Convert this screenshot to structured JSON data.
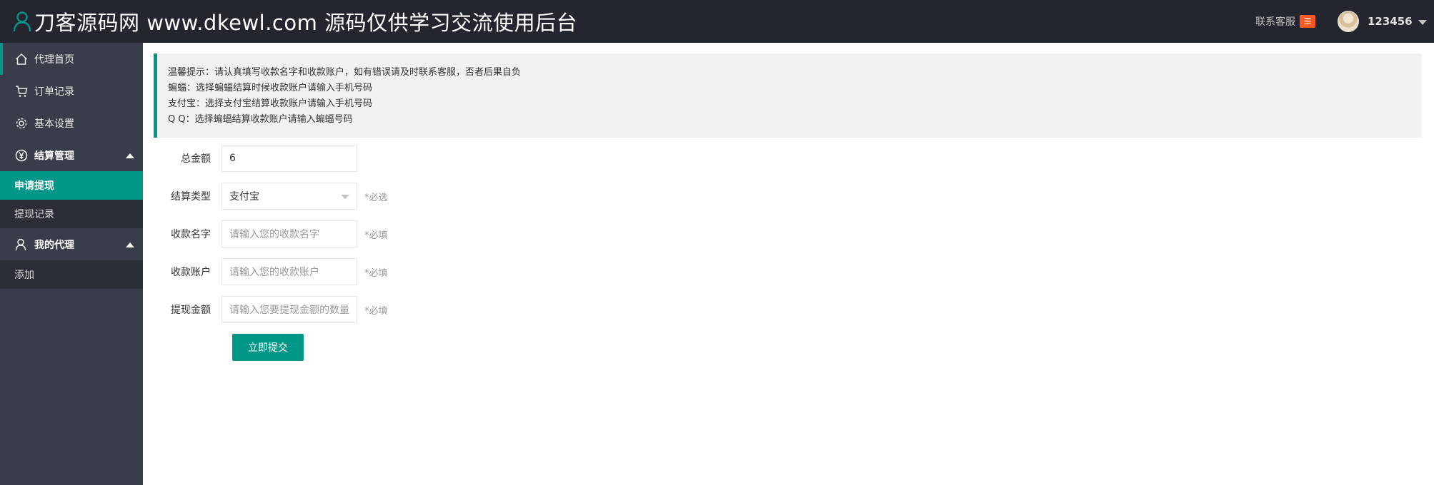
{
  "header": {
    "title": "刀客源码网 www.dkewl.com 源码仅供学习交流使用后台",
    "contact_label": "联系客服",
    "contact_badge": "☰",
    "username": "123456"
  },
  "sidebar": {
    "items": [
      {
        "label": "代理首页",
        "icon": "home-icon"
      },
      {
        "label": "订单记录",
        "icon": "cart-icon"
      },
      {
        "label": "基本设置",
        "icon": "gear-icon"
      }
    ],
    "groups": [
      {
        "label": "结算管理",
        "icon": "yen-icon",
        "children": [
          {
            "label": "申请提现",
            "active": true
          },
          {
            "label": "提现记录",
            "active": false
          }
        ]
      },
      {
        "label": "我的代理",
        "icon": "user-icon",
        "children": [
          {
            "label": "添加",
            "active": false
          }
        ]
      }
    ]
  },
  "notice": {
    "lines": [
      "温馨提示：请认真填写收款名字和收款账户，如有错误请及时联系客服，否者后果自负",
      "蝙蝠：选择蝙蝠结算时候收款账户请输入手机号码",
      "支付宝：选择支付宝结算收款账户请输入手机号码",
      "Q Q：选择蝙蝠结算收款账户请输入蝙蝠号码"
    ]
  },
  "form": {
    "total": {
      "label": "总金额",
      "value": "6"
    },
    "type": {
      "label": "结算类型",
      "value": "支付宝",
      "aux": "*必选"
    },
    "name": {
      "label": "收款名字",
      "placeholder": "请输入您的收款名字",
      "aux": "*必填"
    },
    "account": {
      "label": "收款账户",
      "placeholder": "请输入您的收款账户",
      "aux": "*必填"
    },
    "amount": {
      "label": "提现金额",
      "placeholder": "请输入您要提现金额的数量",
      "aux": "*必填"
    },
    "submit_label": "立即提交"
  },
  "colors": {
    "header_bg": "#23262e",
    "sidebar_bg": "#393d49",
    "accent": "#009688",
    "badge": "#ff5722"
  }
}
